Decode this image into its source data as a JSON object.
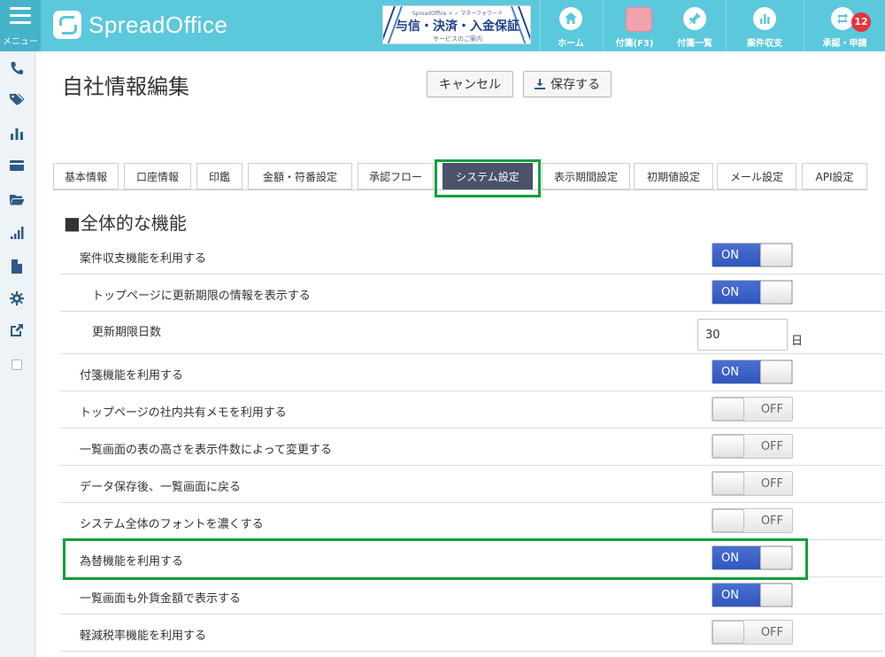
{
  "header": {
    "menu_label": "メニュー",
    "logo_text": "SpreadOffice",
    "banner": {
      "brand": "SpreadOffice × ✓ マネーフォワード",
      "title": "与信・決済・入金保証",
      "subtitle": "サービスのご案内"
    },
    "nav": [
      {
        "label": "ホーム",
        "icon": "home-icon"
      },
      {
        "label": "付箋(F3)",
        "icon": "sticky-note-icon"
      },
      {
        "label": "付箋一覧",
        "icon": "pin-icon"
      },
      {
        "label": "案件収支",
        "icon": "bar-chart-icon"
      },
      {
        "label": "承認・申請",
        "icon": "retweet-icon",
        "badge": "12"
      }
    ]
  },
  "sidebar": {
    "icons": [
      "phone-icon",
      "tags-icon",
      "bar-chart-icon",
      "card-icon",
      "folder-icon",
      "signal-icon",
      "file-icon",
      "gear-icon",
      "external-link-icon",
      "checkbox-icon"
    ]
  },
  "page": {
    "title": "自社情報編集",
    "cancel_label": "キャンセル",
    "save_label": "保存する"
  },
  "tabs": [
    {
      "label": "基本情報",
      "active": false
    },
    {
      "label": "口座情報",
      "active": false
    },
    {
      "label": "印鑑",
      "active": false
    },
    {
      "label": "金額・符番設定",
      "active": false
    },
    {
      "label": "承認フロー",
      "active": false
    },
    {
      "label": "システム設定",
      "active": true
    },
    {
      "label": "表示期間設定",
      "active": false
    },
    {
      "label": "初期値設定",
      "active": false
    },
    {
      "label": "メール設定",
      "active": false
    },
    {
      "label": "API設定",
      "active": false
    }
  ],
  "section": {
    "title": "■全体的な機能"
  },
  "settings": [
    {
      "label": "案件収支機能を利用する",
      "type": "toggle",
      "state": "ON",
      "indent": false
    },
    {
      "label": "トップページに更新期限の情報を表示する",
      "type": "toggle",
      "state": "ON",
      "indent": true
    },
    {
      "label": "更新期限日数",
      "type": "number",
      "value": "30",
      "unit": "日",
      "indent": true
    },
    {
      "label": "付箋機能を利用する",
      "type": "toggle",
      "state": "ON",
      "indent": false
    },
    {
      "label": "トップページの社内共有メモを利用する",
      "type": "toggle",
      "state": "OFF",
      "indent": false
    },
    {
      "label": "一覧画面の表の高さを表示件数によって変更する",
      "type": "toggle",
      "state": "OFF",
      "indent": false
    },
    {
      "label": "データ保存後、一覧画面に戻る",
      "type": "toggle",
      "state": "OFF",
      "indent": false
    },
    {
      "label": "システム全体のフォントを濃くする",
      "type": "toggle",
      "state": "OFF",
      "indent": false
    },
    {
      "label": "為替機能を利用する",
      "type": "toggle",
      "state": "ON",
      "indent": false
    },
    {
      "label": "一覧画面も外貨金額で表示する",
      "type": "toggle",
      "state": "ON",
      "indent": false
    },
    {
      "label": "軽減税率機能を利用する",
      "type": "toggle",
      "state": "OFF",
      "indent": false
    }
  ],
  "colors": {
    "header_bg": "#5bc8dc",
    "toggle_on": "#2f57bf",
    "active_tab": "#4a5168",
    "highlight": "#12a03c"
  }
}
